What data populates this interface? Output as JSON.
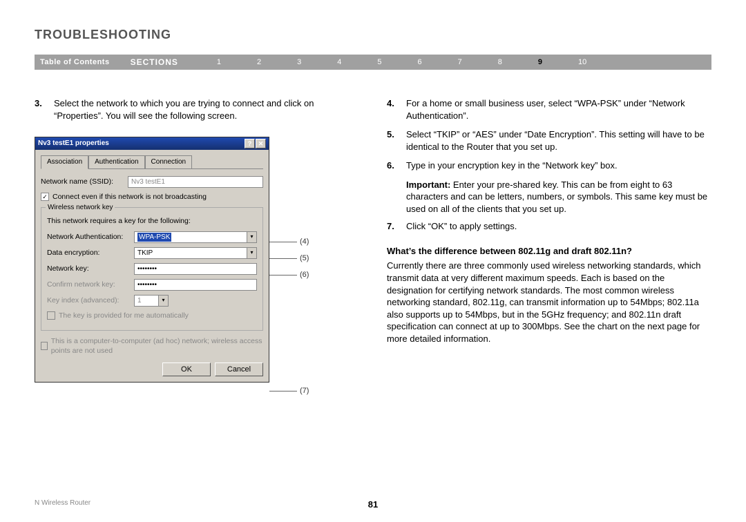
{
  "header": {
    "title": "TROUBLESHOOTING",
    "toc_label": "Table of Contents",
    "sections_label": "SECTIONS",
    "sections": [
      "1",
      "2",
      "3",
      "4",
      "5",
      "6",
      "7",
      "8",
      "9",
      "10"
    ],
    "active_section": "9"
  },
  "left": {
    "item3_num": "3.",
    "item3_text": "Select the network to which you are trying to connect and click on “Properties”. You will see the following screen."
  },
  "dialog": {
    "title": "Nv3 testE1 properties",
    "help_btn": "?",
    "close_btn": "✕",
    "tabs": [
      "Association",
      "Authentication",
      "Connection"
    ],
    "ssid_label": "Network name (SSID):",
    "ssid_value": "Nv3 testE1",
    "connect_chk": "Connect even if this network is not broadcasting",
    "group_title": "Wireless network key",
    "group_note": "This network requires a key for the following:",
    "auth_label": "Network Authentication:",
    "auth_value": "WPA-PSK",
    "enc_label": "Data encryption:",
    "enc_value": "TKIP",
    "key_label": "Network key:",
    "key_value": "••••••••",
    "confirm_label": "Confirm network key:",
    "confirm_value": "••••••••",
    "keyidx_label": "Key index (advanced):",
    "keyidx_value": "1",
    "auto_chk": "The key is provided for me automatically",
    "adhoc_chk": "This is a computer-to-computer (ad hoc) network; wireless access points are not used",
    "ok": "OK",
    "cancel": "Cancel"
  },
  "callouts": {
    "c4": "(4)",
    "c5": "(5)",
    "c6": "(6)",
    "c7": "(7)"
  },
  "right": {
    "item4_num": "4.",
    "item4_text": "For a home or small business user, select “WPA-PSK” under “Network Authentication”.",
    "item5_num": "5.",
    "item5_text": "Select “TKIP” or “AES” under “Date Encryption”. This setting will have to be identical to the Router that you set up.",
    "item6_num": "6.",
    "item6_text": "Type in your encryption key in the “Network key” box.",
    "important_label": "Important:",
    "important_text": " Enter your pre-shared key. This can be from eight to 63 characters and can be letters, numbers, or symbols. This same key must be used on all of the clients that you set up.",
    "item7_num": "7.",
    "item7_text": "Click “OK” to apply settings.",
    "subhead": "What’s the difference between 802.11g and draft 802.11n?",
    "para": "Currently there are three commonly used wireless networking standards, which transmit data at very different maximum speeds. Each is based on the designation for certifying network standards. The most common wireless networking standard, 802.11g, can transmit information up to 54Mbps; 802.11a also supports up to 54Mbps, but in the 5GHz frequency; and 802.11n draft specification can connect at up to 300Mbps. See the chart on the next page for more detailed information."
  },
  "footer": {
    "product": "N Wireless Router",
    "page": "81"
  }
}
